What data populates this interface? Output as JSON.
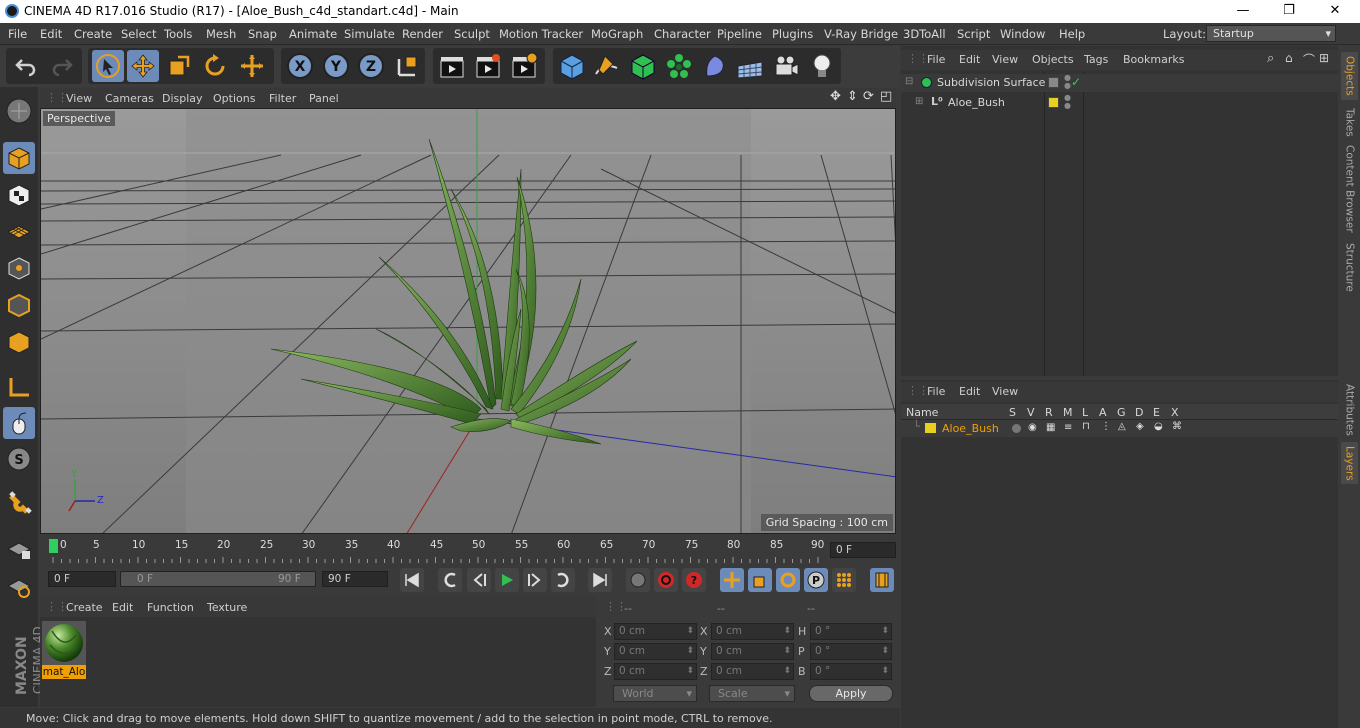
{
  "window": {
    "title": "CINEMA 4D R17.016 Studio (R17) - [Aloe_Bush_c4d_standart.c4d] - Main",
    "minimize": "—",
    "maximize": "❐",
    "close": "✕"
  },
  "menubar": {
    "items": [
      "File",
      "Edit",
      "Create",
      "Select",
      "Tools",
      "Mesh",
      "Snap",
      "Animate",
      "Simulate",
      "Render",
      "Sculpt",
      "Motion Tracker",
      "MoGraph",
      "Character",
      "Pipeline",
      "Plugins",
      "V-Ray Bridge",
      "3DToAll",
      "Script",
      "Window",
      "Help"
    ],
    "layout_label": "Layout:",
    "layout_value": "Startup"
  },
  "viewport": {
    "menu": [
      "View",
      "Cameras",
      "Display",
      "Options",
      "Filter",
      "Panel"
    ],
    "label": "Perspective",
    "grid_spacing": "Grid Spacing : 100 cm",
    "axis_x": "Z",
    "axis_y": "Y"
  },
  "timeline": {
    "ticks": [
      "0",
      "5",
      "10",
      "15",
      "20",
      "25",
      "30",
      "35",
      "40",
      "45",
      "50",
      "55",
      "60",
      "65",
      "70",
      "75",
      "80",
      "85",
      "90"
    ],
    "current_frame": "0 F"
  },
  "playbar": {
    "start": "0 F",
    "range_start": "0 F",
    "range_end": "90 F",
    "end": "90 F"
  },
  "materials": {
    "menu": [
      "Create",
      "Edit",
      "Function",
      "Texture"
    ],
    "items": [
      {
        "name": "mat_Alo"
      }
    ]
  },
  "coords": {
    "headers": [
      "--",
      "--",
      "--"
    ],
    "pos": [
      {
        "axis": "X",
        "value": "0 cm"
      },
      {
        "axis": "Y",
        "value": "0 cm"
      },
      {
        "axis": "Z",
        "value": "0 cm"
      }
    ],
    "scale": [
      {
        "axis": "X",
        "value": "0 cm"
      },
      {
        "axis": "Y",
        "value": "0 cm"
      },
      {
        "axis": "Z",
        "value": "0 cm"
      }
    ],
    "rot": [
      {
        "axis": "H",
        "value": "0 °"
      },
      {
        "axis": "P",
        "value": "0 °"
      },
      {
        "axis": "B",
        "value": "0 °"
      }
    ],
    "mode": "World",
    "size_mode": "Scale",
    "apply": "Apply"
  },
  "objects": {
    "menu": [
      "File",
      "Edit",
      "View",
      "Objects",
      "Tags",
      "Bookmarks"
    ],
    "tree": [
      {
        "name": "Subdivision Surface"
      },
      {
        "name": "Aloe_Bush"
      }
    ]
  },
  "layers": {
    "menu": [
      "File",
      "Edit",
      "View"
    ],
    "columns": [
      "Name",
      "S",
      "V",
      "R",
      "M",
      "L",
      "A",
      "G",
      "D",
      "E",
      "X"
    ],
    "rows": [
      {
        "name": "Aloe_Bush"
      }
    ]
  },
  "sidetabs": [
    "Objects",
    "Takes",
    "Content Browser",
    "Structure",
    "Attributes",
    "Layers"
  ],
  "status": "Move: Click and drag to move elements. Hold down SHIFT to quantize movement / add to the selection in point mode, CTRL to remove.",
  "brand": {
    "maxon": "MAXON",
    "cinema": "CINEMA 4D"
  },
  "colors": {
    "accent": "#6d8bb8",
    "layer_color": "#e8d020",
    "active_tab": "#e8a020"
  }
}
